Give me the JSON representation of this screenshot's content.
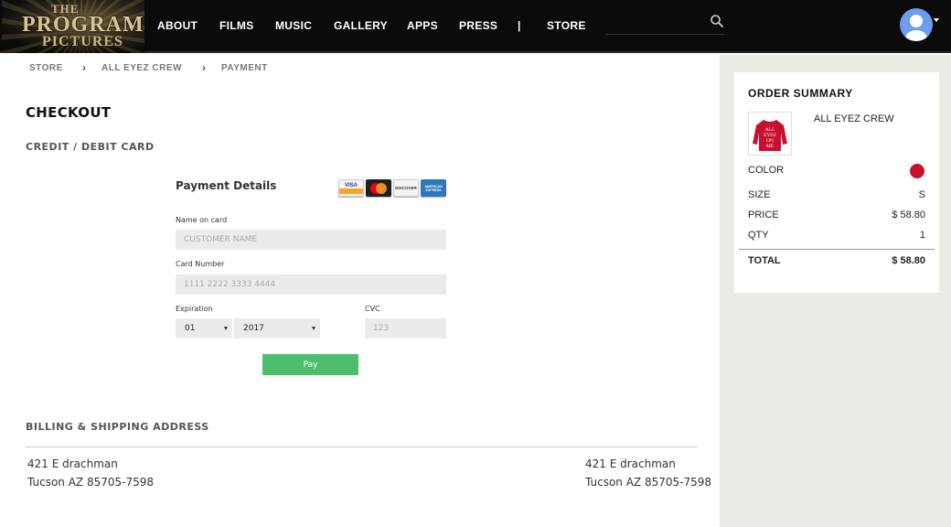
{
  "header": {
    "logo": {
      "line1": "THE",
      "line2": "PROGRAM",
      "line3": "PICTURES"
    },
    "nav": [
      "ABOUT",
      "FILMS",
      "MUSIC",
      "GALLERY",
      "APPS",
      "PRESS",
      "STORE"
    ],
    "nav_separator": "|",
    "search": {
      "placeholder": "",
      "icon": "search-icon"
    },
    "user": {
      "icon": "user-avatar-icon",
      "color": "#6d9cf0"
    }
  },
  "breadcrumb": [
    "STORE",
    "ALL EYEZ CREW",
    "PAYMENT"
  ],
  "checkout": {
    "title": "CHECKOUT",
    "card_section_title": "CREDIT / DEBIT CARD",
    "payment": {
      "heading": "Payment Details",
      "cards": [
        "VISA",
        "MasterCard",
        "DISCOVER",
        "AMERICAN EXPRESS"
      ],
      "name_label": "Name on card",
      "name_placeholder": "CUSTOMER NAME",
      "number_label": "Card Number",
      "number_placeholder": "1111 2222 3333 4444",
      "expiration_label": "Expiration",
      "exp_month": "01",
      "exp_year": "2017",
      "cvc_label": "CVC",
      "cvc_placeholder": "123",
      "pay_label": "Pay",
      "pay_color": "#4cbf6d"
    },
    "billing_section_title": "BILLING & SHIPPING ADDRESS",
    "billing_address": {
      "line1": "421 E drachman",
      "line2": "Tucson AZ 85705-7598"
    },
    "shipping_address": {
      "line1": "421 E drachman",
      "line2": "Tucson AZ 85705-7598"
    }
  },
  "order_summary": {
    "title": "ORDER SUMMARY",
    "product_name": "ALL EYEZ CREW",
    "product_print": [
      "ALL",
      "EYEZ",
      "ON",
      "ME"
    ],
    "color_label": "COLOR",
    "color_value": "#c8102e",
    "size_label": "SIZE",
    "size_value": "S",
    "price_label": "PRICE",
    "price_value": "$ 58.80",
    "qty_label": "QTY",
    "qty_value": "1",
    "total_label": "TOTAL",
    "total_value": "$ 58.80"
  }
}
